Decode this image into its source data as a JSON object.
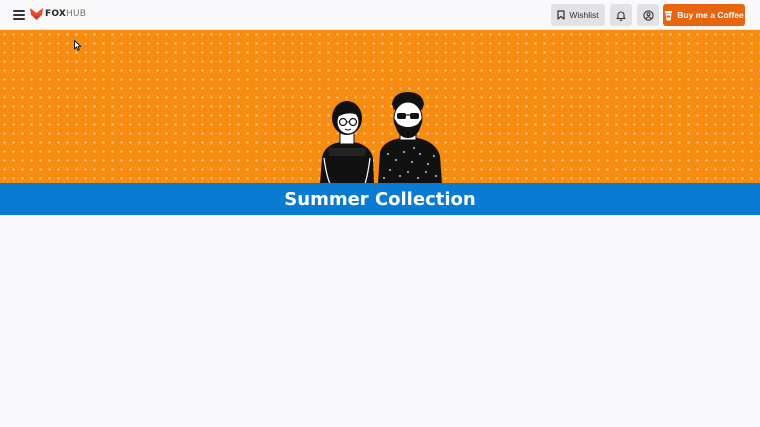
{
  "header": {
    "menu_icon": "hamburger-menu-icon",
    "logo": {
      "brand_bold": "FOX",
      "brand_light": "HUB",
      "icon": "fox-icon",
      "accent": "#e84a2a"
    },
    "wishlist_label": "Wishlist",
    "wishlist_icon": "bookmark-icon",
    "notifications_icon": "bell-icon",
    "account_icon": "user-circle-icon",
    "coffee_label": "Buy me a Coffee",
    "coffee_icon": "coffee-cup-icon"
  },
  "hero": {
    "background_color": "#f78c13",
    "illustration": "couple-illustration"
  },
  "banner": {
    "title": "Summer Collection",
    "background_color": "#0a7bd2"
  },
  "colors": {
    "accent_button": "#e8650d",
    "page_background": "#f9f9fb"
  }
}
